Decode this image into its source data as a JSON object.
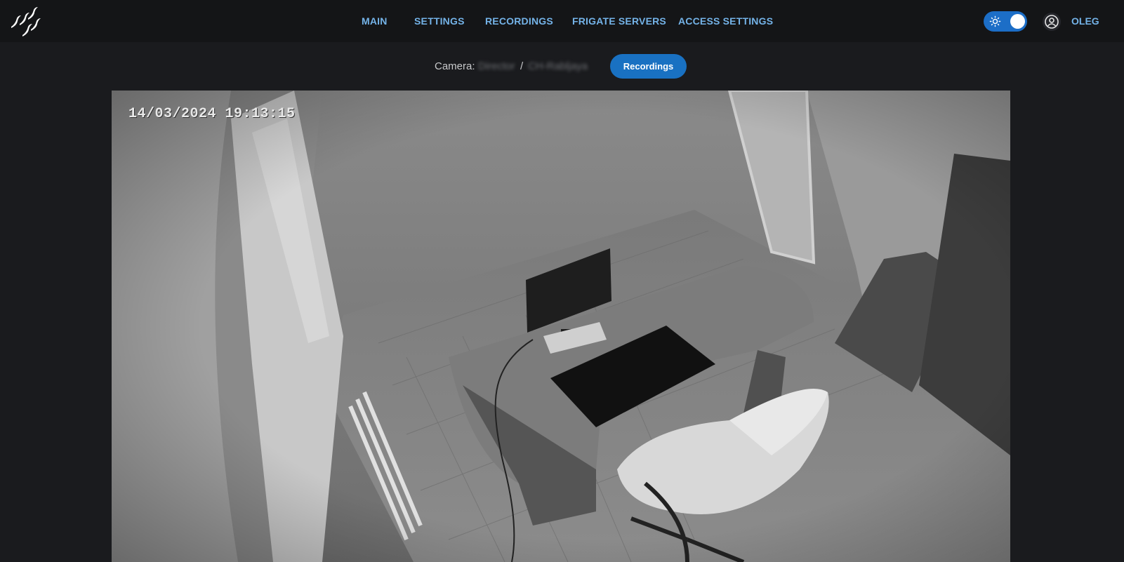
{
  "nav": {
    "items": [
      {
        "label": "MAIN"
      },
      {
        "label": "SETTINGS"
      },
      {
        "label": "RECORDINGS"
      },
      {
        "label": "FRIGATE SERVERS"
      },
      {
        "label": "ACCESS SETTINGS"
      }
    ]
  },
  "user": {
    "name": "OLEG"
  },
  "theme": {
    "icon": "sun-icon",
    "accent": "#1c6ec7"
  },
  "camera": {
    "label": "Camera:",
    "host": "Director",
    "separator": "/",
    "name": "CH-Rabljaya",
    "recordings_button": "Recordings"
  },
  "video": {
    "timestamp": "14/03/2024 19:13:15"
  },
  "colors": {
    "nav_text": "#74b3e8",
    "button_bg": "#1971c2",
    "page_bg": "#1a1b1e"
  }
}
